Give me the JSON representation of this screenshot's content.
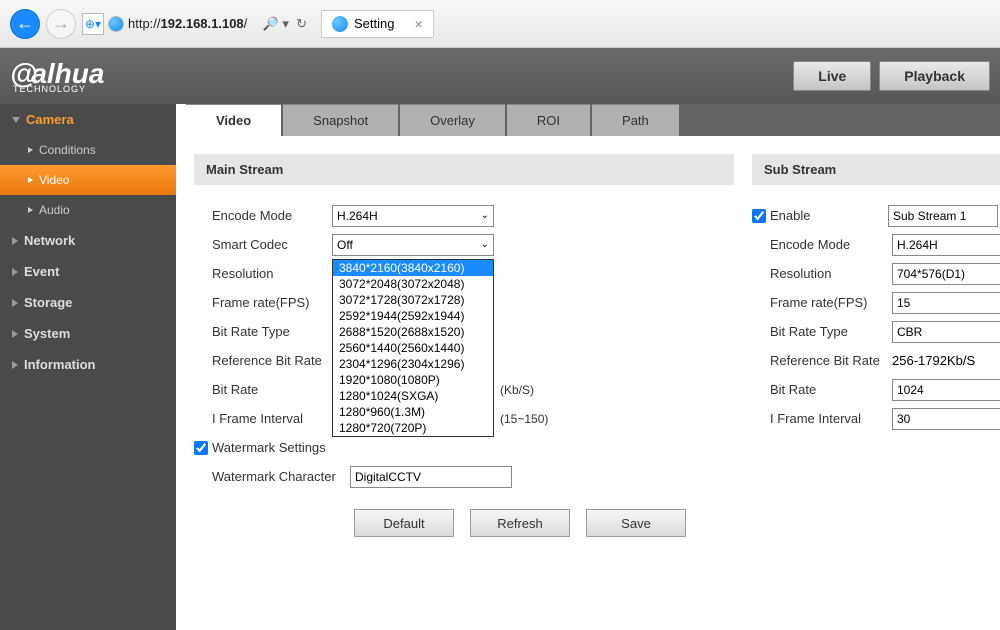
{
  "browser": {
    "url_prefix": "http://",
    "url_host": "192.168.1.108",
    "url_suffix": "/",
    "search_hint": "🔎 ▾ 🖒",
    "tab_title": "Setting"
  },
  "brand": {
    "name": "alhua",
    "sub": "TECHNOLOGY"
  },
  "header_buttons": {
    "live": "Live",
    "playback": "Playback"
  },
  "sidebar": {
    "camera": "Camera",
    "conditions": "Conditions",
    "video": "Video",
    "audio": "Audio",
    "network": "Network",
    "event": "Event",
    "storage": "Storage",
    "system": "System",
    "information": "Information"
  },
  "tabs": {
    "video": "Video",
    "snapshot": "Snapshot",
    "overlay": "Overlay",
    "roi": "ROI",
    "path": "Path"
  },
  "main_stream": {
    "title": "Main Stream",
    "encode_mode_label": "Encode Mode",
    "encode_mode_value": "H.264H",
    "smart_codec_label": "Smart Codec",
    "smart_codec_value": "Off",
    "resolution_label": "Resolution",
    "resolution_options": [
      "3840*2160(3840x2160)",
      "3072*2048(3072x2048)",
      "3072*1728(3072x1728)",
      "2592*1944(2592x1944)",
      "2688*1520(2688x1520)",
      "2560*1440(2560x1440)",
      "2304*1296(2304x1296)",
      "1920*1080(1080P)",
      "1280*1024(SXGA)",
      "1280*960(1.3M)",
      "1280*720(720P)"
    ],
    "frame_rate_label": "Frame rate(FPS)",
    "bit_rate_type_label": "Bit Rate Type",
    "ref_bit_rate_label": "Reference Bit Rate",
    "bit_rate_label": "Bit Rate",
    "bit_rate_unit": "(Kb/S)",
    "i_frame_label": "I Frame Interval",
    "i_frame_unit": "(15~150)",
    "watermark_settings": "Watermark Settings",
    "watermark_char_label": "Watermark Character",
    "watermark_value": "DigitalCCTV"
  },
  "sub_stream": {
    "title": "Sub Stream",
    "enable_label": "Enable",
    "enable_value": "Sub Stream 1",
    "encode_mode_label": "Encode Mode",
    "encode_mode_value": "H.264H",
    "resolution_label": "Resolution",
    "resolution_value": "704*576(D1)",
    "frame_rate_label": "Frame rate(FPS)",
    "frame_rate_value": "15",
    "bit_rate_type_label": "Bit Rate Type",
    "bit_rate_type_value": "CBR",
    "ref_bit_rate_label": "Reference Bit Rate",
    "ref_bit_rate_value": "256-1792Kb/S",
    "bit_rate_label": "Bit Rate",
    "bit_rate_value": "1024",
    "i_frame_label": "I Frame Interval",
    "i_frame_value": "30"
  },
  "buttons": {
    "default": "Default",
    "refresh": "Refresh",
    "save": "Save"
  }
}
